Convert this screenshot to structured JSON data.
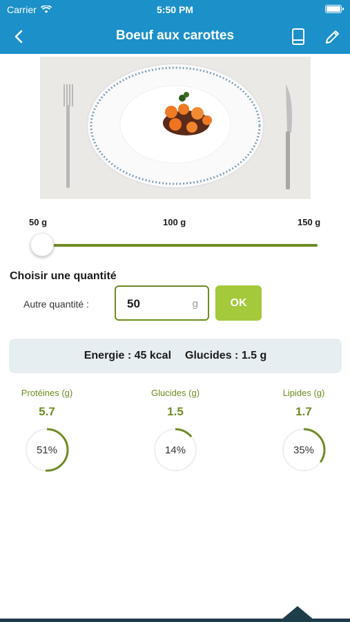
{
  "status_bar": {
    "carrier": "Carrier",
    "time": "5:50 PM"
  },
  "nav": {
    "title": "Boeuf aux carottes",
    "back_icon": "chevron-left-icon",
    "book_icon": "book-icon",
    "edit_icon": "pencil-icon"
  },
  "photo": {
    "subject": "plate-with-beef-and-carrots"
  },
  "slider": {
    "labels": [
      "50 g",
      "100 g",
      "150 g"
    ],
    "value_g": 50,
    "min_g": 50,
    "max_g": 150,
    "color": "#6d8b22"
  },
  "quantity": {
    "title": "Choisir une quantité",
    "label": "Autre quantité :",
    "value": "50",
    "unit": "g",
    "ok_label": "OK"
  },
  "summary": {
    "energy": "Energie : 45 kcal",
    "carbs": "Glucides : 1.5 g"
  },
  "macros": [
    {
      "label": "Protéines (g)",
      "value": "5.7",
      "percent": "51%",
      "fraction": 0.51
    },
    {
      "label": "Glucides (g)",
      "value": "1.5",
      "percent": "14%",
      "fraction": 0.14
    },
    {
      "label": "Lipides (g)",
      "value": "1.7",
      "percent": "35%",
      "fraction": 0.35
    }
  ],
  "colors": {
    "header": "#1b90c9",
    "accent": "#6d8b22",
    "button": "#a4c93a"
  }
}
